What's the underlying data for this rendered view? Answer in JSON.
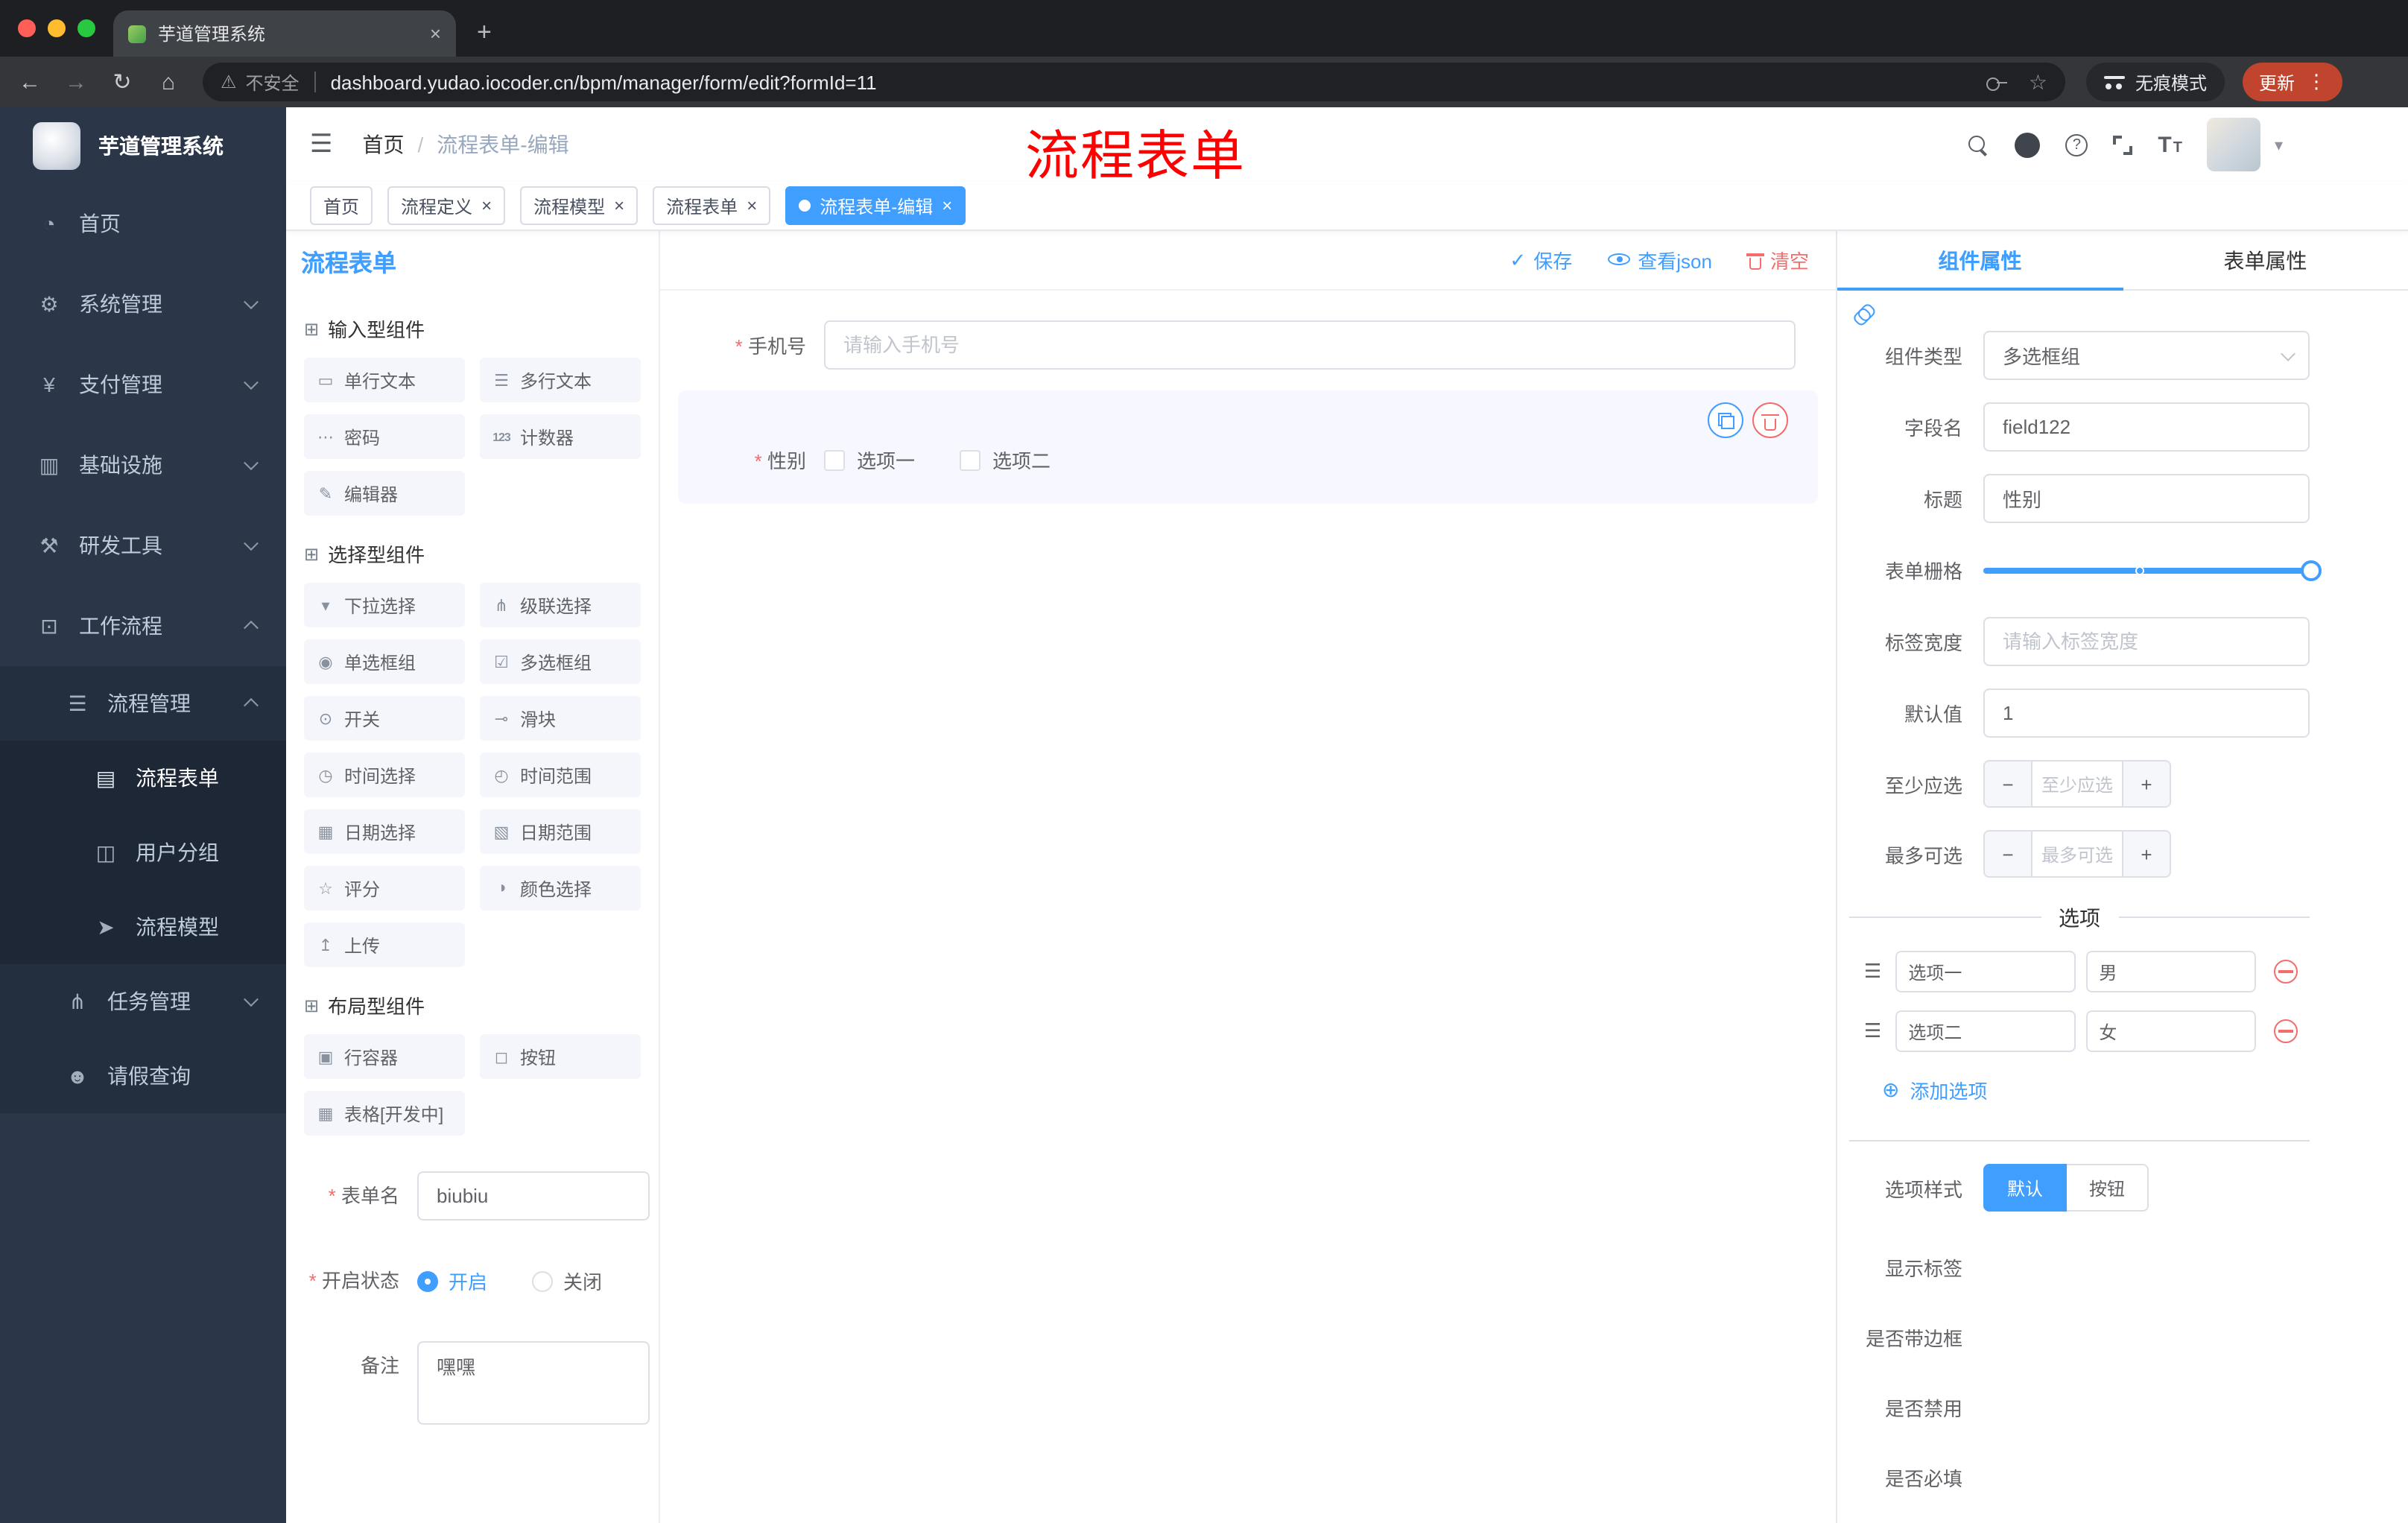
{
  "ui": {
    "close_glyph": "×",
    "plus_glyph": "+",
    "minus_glyph": "−",
    "circle_plus_glyph": "⊕",
    "check_glyph": "✓",
    "caret_glyph": "▾",
    "back_glyph": "←",
    "forward_glyph": "→",
    "reload_glyph": "↻",
    "home_glyph": "⌂",
    "warning_glyph": "⚠",
    "star_glyph": "☆",
    "question_glyph": "?",
    "text_icon": "T",
    "hamburger_glyph": "☰",
    "kebab_glyph": "⋮"
  },
  "browser": {
    "tab_title": "芋道管理系统",
    "security_label": "不安全",
    "url": "dashboard.yudao.iocoder.cn/bpm/manager/form/edit?formId=11",
    "incognito_label": "无痕模式",
    "update_label": "更新"
  },
  "sidebar": {
    "logo_title": "芋道管理系统",
    "items": [
      {
        "label": "首页",
        "glyph": "◔"
      },
      {
        "label": "系统管理",
        "glyph": "⚙"
      },
      {
        "label": "支付管理",
        "glyph": "¥"
      },
      {
        "label": "基础设施",
        "glyph": "▥"
      },
      {
        "label": "研发工具",
        "glyph": "⚒"
      },
      {
        "label": "工作流程",
        "glyph": "⊡"
      },
      {
        "label": "流程管理",
        "glyph": "☰"
      },
      {
        "label": "流程表单",
        "glyph": "▤"
      },
      {
        "label": "用户分组",
        "glyph": "◫"
      },
      {
        "label": "流程模型",
        "glyph": "➤"
      },
      {
        "label": "任务管理",
        "glyph": "⋔"
      },
      {
        "label": "请假查询",
        "glyph": "☻"
      }
    ]
  },
  "header": {
    "breadcrumb_home": "首页",
    "breadcrumb_sep": "/",
    "breadcrumb_current": "流程表单-编辑",
    "overlay_title": "流程表单"
  },
  "tags": [
    {
      "label": "首页"
    },
    {
      "label": "流程定义"
    },
    {
      "label": "流程模型"
    },
    {
      "label": "流程表单"
    },
    {
      "label": "流程表单-编辑"
    }
  ],
  "designer": {
    "panel_title": "流程表单",
    "actions": {
      "save": "保存",
      "view_json": "查看json",
      "clear": "清空"
    },
    "palette": {
      "sections": [
        {
          "title": "输入型组件",
          "items": [
            {
              "label": "单行文本",
              "glyph": "▭"
            },
            {
              "label": "多行文本",
              "glyph": "☰"
            },
            {
              "label": "密码",
              "glyph": "⋯"
            },
            {
              "label": "计数器",
              "glyph": "123"
            },
            {
              "label": "编辑器",
              "glyph": "✎"
            }
          ]
        },
        {
          "title": "选择型组件",
          "items": [
            {
              "label": "下拉选择",
              "glyph": "▾"
            },
            {
              "label": "级联选择",
              "glyph": "⋔"
            },
            {
              "label": "单选框组",
              "glyph": "◉"
            },
            {
              "label": "多选框组",
              "glyph": "☑"
            },
            {
              "label": "开关",
              "glyph": "⊙"
            },
            {
              "label": "滑块",
              "glyph": "⊸"
            },
            {
              "label": "时间选择",
              "glyph": "◷"
            },
            {
              "label": "时间范围",
              "glyph": "◴"
            },
            {
              "label": "日期选择",
              "glyph": "▦"
            },
            {
              "label": "日期范围",
              "glyph": "▧"
            },
            {
              "label": "评分",
              "glyph": "☆"
            },
            {
              "label": "颜色选择",
              "glyph": "◑"
            },
            {
              "label": "上传",
              "glyph": "↥"
            }
          ]
        },
        {
          "title": "布局型组件",
          "items": [
            {
              "label": "行容器",
              "glyph": "▣"
            },
            {
              "label": "按钮",
              "glyph": "◻"
            },
            {
              "label": "表格[开发中]",
              "glyph": "▦"
            }
          ]
        }
      ]
    },
    "form_settings": {
      "name_label": "表单名",
      "name_value": "biubiu",
      "status_label": "开启状态",
      "status_on": "开启",
      "status_off": "关闭",
      "remark_label": "备注",
      "remark_value": "嘿嘿"
    },
    "canvas": {
      "phone": {
        "label": "手机号",
        "placeholder": "请输入手机号"
      },
      "gender": {
        "label": "性别",
        "option1": "选项一",
        "option2": "选项二"
      }
    }
  },
  "properties": {
    "tab_component": "组件属性",
    "tab_form": "表单属性",
    "component_type_label": "组件类型",
    "component_type_value": "多选框组",
    "field_name_label": "字段名",
    "field_name_value": "field122",
    "title_label": "标题",
    "title_value": "性别",
    "grid_label": "表单栅格",
    "label_width_label": "标签宽度",
    "label_width_placeholder": "请输入标签宽度",
    "default_label": "默认值",
    "default_value": "1",
    "min_label": "至少应选",
    "min_placeholder": "至少应选",
    "max_label": "最多可选",
    "max_placeholder": "最多可选",
    "options_divider": "选项",
    "options": [
      {
        "label": "选项一",
        "value": "男"
      },
      {
        "label": "选项二",
        "value": "女"
      }
    ],
    "add_option": "添加选项",
    "style_label": "选项样式",
    "style_default": "默认",
    "style_button": "按钮",
    "show_label": "显示标签",
    "border_label": "是否带边框",
    "disabled_label": "是否禁用",
    "required_label": "是否必填"
  },
  "colors": {
    "primary": "#409eff",
    "danger": "#f56c6c",
    "annotation": "#fe0000"
  }
}
